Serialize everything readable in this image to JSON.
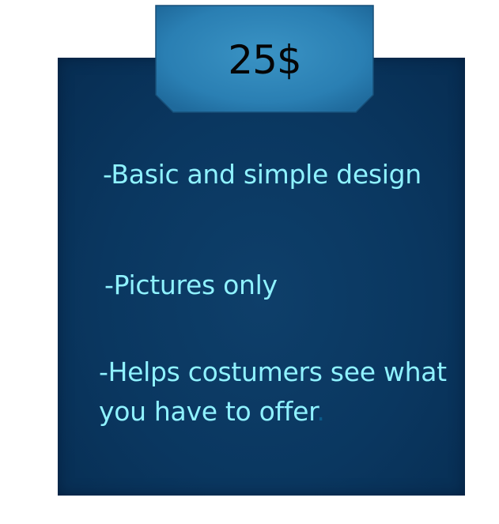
{
  "price": "25$",
  "features": [
    "-Basic and simple design",
    "-Pictures only",
    "-Helps costumers see what",
    "you have to offer"
  ],
  "trailing_punctuation": ".",
  "colors": {
    "card": "#0a3760",
    "tab": "#2c82b5",
    "feature_text": "#8ff2ff",
    "price_text": "#050505"
  }
}
